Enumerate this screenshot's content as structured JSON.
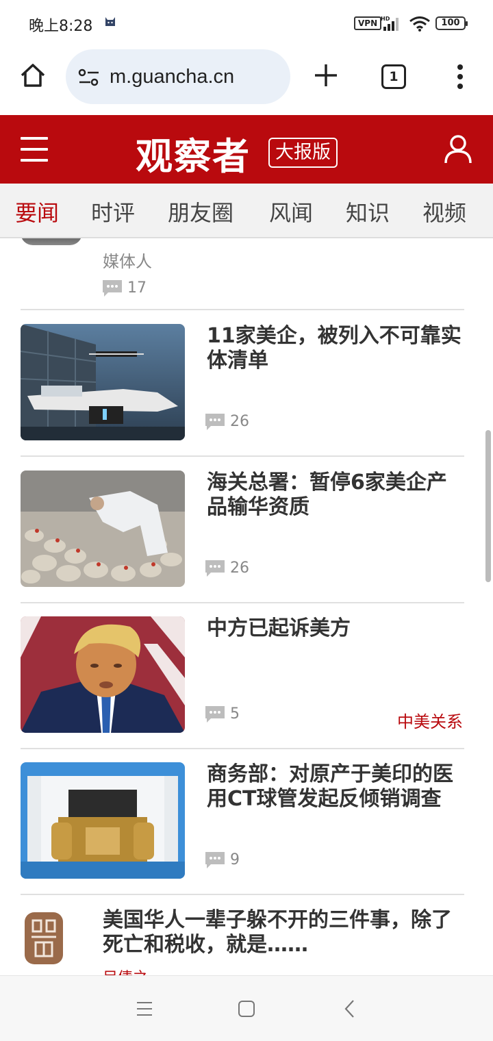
{
  "status_bar": {
    "time": "晚上8:28",
    "vpn": "VPN",
    "network": "HD",
    "battery": "100"
  },
  "browser": {
    "url": "m.guancha.cn",
    "tab_count": "1"
  },
  "site": {
    "logo": "观察者",
    "edition": "大报版"
  },
  "nav_tabs": [
    {
      "label": "要闻",
      "active": true
    },
    {
      "label": "时评"
    },
    {
      "label": "朋友圈"
    },
    {
      "label": "风闻"
    },
    {
      "label": "知识"
    },
    {
      "label": "视频"
    }
  ],
  "top_partial": {
    "role": "媒体人",
    "comments": "17"
  },
  "articles": [
    {
      "title": "11家美企，被列入不可靠实体清单",
      "comments": "26",
      "tag": "",
      "image": "drone-photo"
    },
    {
      "title": "海关总署：暂停6家美企产品输华资质",
      "comments": "26",
      "tag": "",
      "image": "poultry-farm-photo"
    },
    {
      "title": "中方已起诉美方",
      "comments": "5",
      "tag": "中美关系",
      "image": "politician-portrait-photo"
    },
    {
      "title": "商务部：对原产于美印的医用CT球管发起反倾销调查",
      "comments": "9",
      "tag": "",
      "image": "ct-tube-photo"
    }
  ],
  "last_article": {
    "title": "美国华人一辈子躲不开的三件事，除了死亡和税收，就是……",
    "author": "目倩之"
  },
  "colors": {
    "brand_red": "#b90a0e",
    "tab_bg": "#f2f2f2",
    "url_bg": "#eaf0f8"
  }
}
